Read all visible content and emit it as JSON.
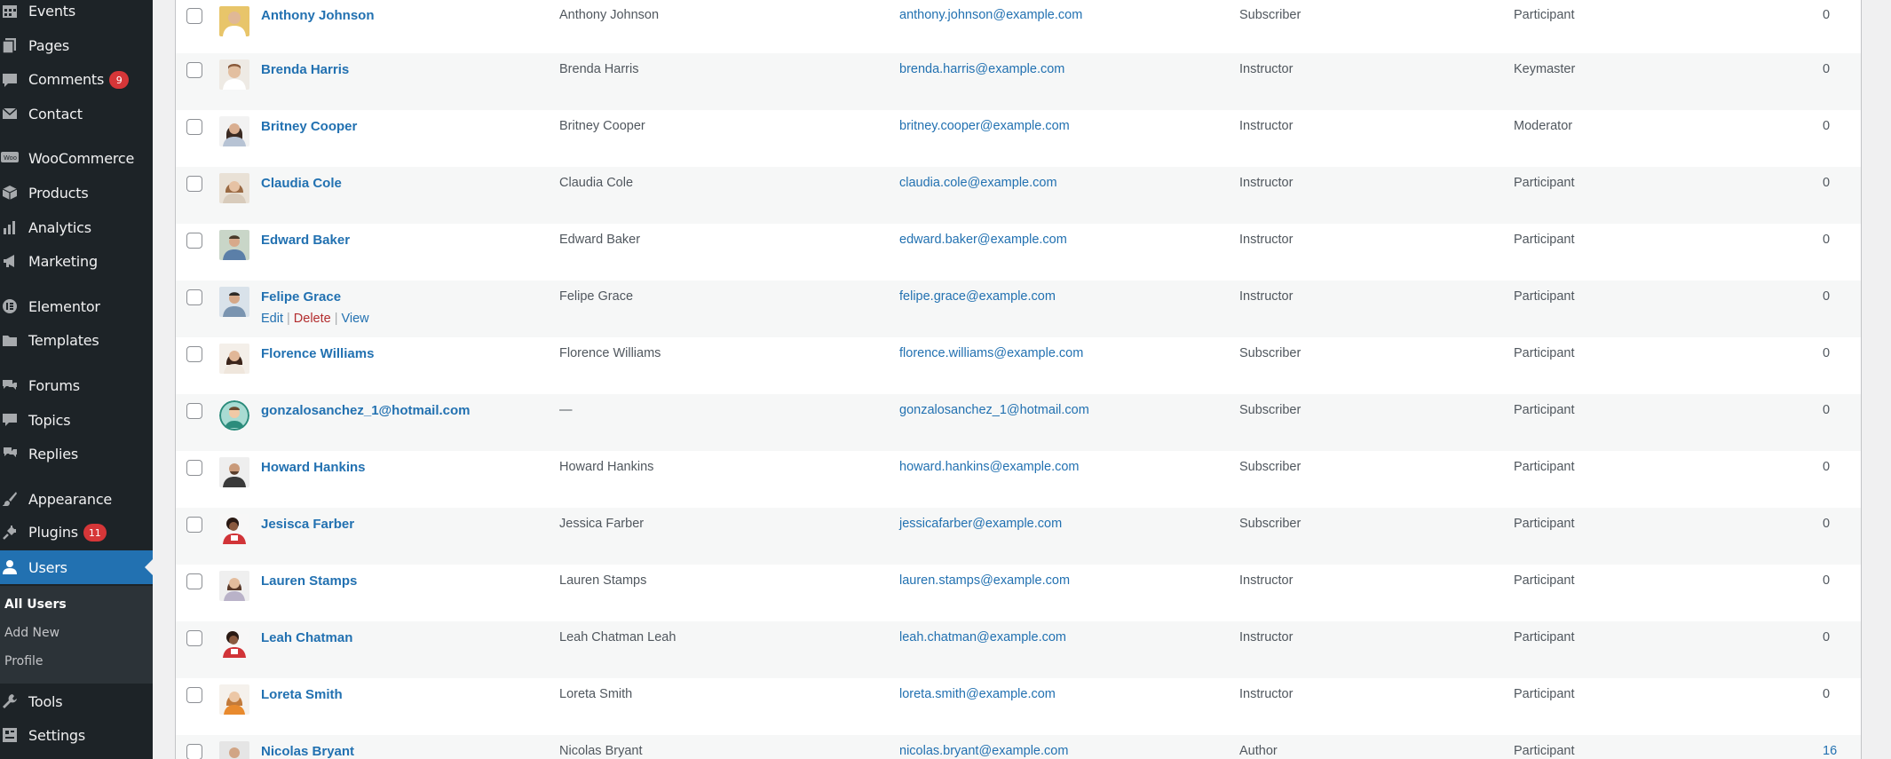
{
  "sidebar": {
    "items": [
      {
        "label": "Events",
        "icon": "calendar-icon"
      },
      {
        "label": "Pages",
        "icon": "pages-icon"
      },
      {
        "label": "Comments",
        "icon": "comment-icon",
        "badge": "9"
      },
      {
        "label": "Contact",
        "icon": "mail-icon"
      },
      {
        "label": "WooCommerce",
        "icon": "woo-icon"
      },
      {
        "label": "Products",
        "icon": "box-icon"
      },
      {
        "label": "Analytics",
        "icon": "bar-chart-icon"
      },
      {
        "label": "Marketing",
        "icon": "megaphone-icon"
      },
      {
        "label": "Elementor",
        "icon": "elementor-icon"
      },
      {
        "label": "Templates",
        "icon": "folder-icon"
      },
      {
        "label": "Forums",
        "icon": "forum-icon"
      },
      {
        "label": "Topics",
        "icon": "topics-icon"
      },
      {
        "label": "Replies",
        "icon": "replies-icon"
      },
      {
        "label": "Appearance",
        "icon": "brush-icon"
      },
      {
        "label": "Plugins",
        "icon": "plugin-icon",
        "badge": "11"
      },
      {
        "label": "Users",
        "icon": "user-icon",
        "active": true
      },
      {
        "label": "Tools",
        "icon": "wrench-icon"
      },
      {
        "label": "Settings",
        "icon": "settings-icon"
      }
    ],
    "submenu": [
      "All Users",
      "Add New",
      "Profile"
    ]
  },
  "users": [
    {
      "username": "Anthony Johnson",
      "name": "Anthony Johnson",
      "email": "anthony.johnson@example.com",
      "role": "Subscriber",
      "forum_role": "Participant",
      "posts": "0"
    },
    {
      "username": "Brenda Harris",
      "name": "Brenda Harris",
      "email": "brenda.harris@example.com",
      "role": "Instructor",
      "forum_role": "Keymaster",
      "posts": "0"
    },
    {
      "username": "Britney Cooper",
      "name": "Britney Cooper",
      "email": "britney.cooper@example.com",
      "role": "Instructor",
      "forum_role": "Moderator",
      "posts": "0"
    },
    {
      "username": "Claudia Cole",
      "name": "Claudia Cole",
      "email": "claudia.cole@example.com",
      "role": "Instructor",
      "forum_role": "Participant",
      "posts": "0"
    },
    {
      "username": "Edward Baker",
      "name": "Edward Baker",
      "email": "edward.baker@example.com",
      "role": "Instructor",
      "forum_role": "Participant",
      "posts": "0"
    },
    {
      "username": "Felipe Grace",
      "name": "Felipe Grace",
      "email": "felipe.grace@example.com",
      "role": "Instructor",
      "forum_role": "Participant",
      "posts": "0"
    },
    {
      "username": "Florence Williams",
      "name": "Florence Williams",
      "email": "florence.williams@example.com",
      "role": "Subscriber",
      "forum_role": "Participant",
      "posts": "0"
    },
    {
      "username": "gonzalosanchez_1@hotmail.com",
      "name": "—",
      "email": "gonzalosanchez_1@hotmail.com",
      "role": "Subscriber",
      "forum_role": "Participant",
      "posts": "0"
    },
    {
      "username": "Howard Hankins",
      "name": "Howard Hankins",
      "email": "howard.hankins@example.com",
      "role": "Subscriber",
      "forum_role": "Participant",
      "posts": "0"
    },
    {
      "username": "Jesisca Farber",
      "name": "Jessica Farber",
      "email": "jessicafarber@example.com",
      "role": "Subscriber",
      "forum_role": "Participant",
      "posts": "0"
    },
    {
      "username": "Lauren Stamps",
      "name": "Lauren Stamps",
      "email": "lauren.stamps@example.com",
      "role": "Instructor",
      "forum_role": "Participant",
      "posts": "0"
    },
    {
      "username": "Leah Chatman",
      "name": "Leah Chatman Leah",
      "email": "leah.chatman@example.com",
      "role": "Instructor",
      "forum_role": "Participant",
      "posts": "0"
    },
    {
      "username": "Loreta Smith",
      "name": "Loreta Smith",
      "email": "loreta.smith@example.com",
      "role": "Instructor",
      "forum_role": "Participant",
      "posts": "0"
    },
    {
      "username": "Nicolas Bryant",
      "name": "Nicolas Bryant",
      "email": "nicolas.bryant@example.com",
      "role": "Author",
      "forum_role": "Participant",
      "posts": "16"
    }
  ],
  "row_actions": {
    "edit": "Edit",
    "delete": "Delete",
    "view": "View"
  },
  "colors": {
    "accent": "#2271b1",
    "sidebar_bg": "#1d2327",
    "badge": "#d63638"
  }
}
